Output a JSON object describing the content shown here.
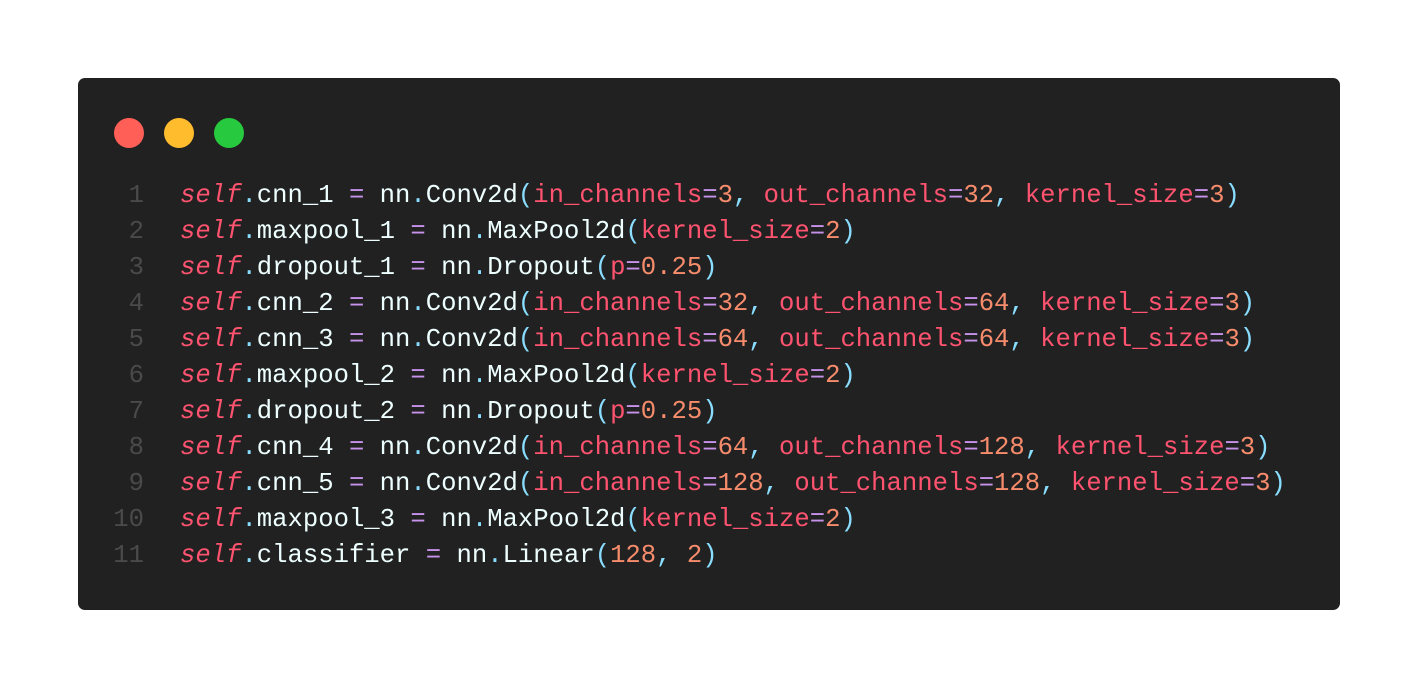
{
  "window": {
    "controls": [
      {
        "name": "close",
        "color": "#ff5f56"
      },
      {
        "name": "minimize",
        "color": "#ffbd2e"
      },
      {
        "name": "maximize",
        "color": "#27c93f"
      }
    ]
  },
  "code": {
    "lines": [
      {
        "n": "1",
        "tokens": [
          [
            "self",
            "self"
          ],
          [
            "punc",
            "."
          ],
          [
            "id",
            "cnn_1 "
          ],
          [
            "op",
            "="
          ],
          [
            "id",
            " nn"
          ],
          [
            "punc",
            "."
          ],
          [
            "id",
            "Conv2d"
          ],
          [
            "punc",
            "("
          ],
          [
            "kw",
            "in_channels"
          ],
          [
            "op",
            "="
          ],
          [
            "num",
            "3"
          ],
          [
            "punc",
            ", "
          ],
          [
            "kw",
            "out_channels"
          ],
          [
            "op",
            "="
          ],
          [
            "num",
            "32"
          ],
          [
            "punc",
            ", "
          ],
          [
            "kw",
            "kernel_size"
          ],
          [
            "op",
            "="
          ],
          [
            "num",
            "3"
          ],
          [
            "punc",
            ")"
          ]
        ]
      },
      {
        "n": "2",
        "tokens": [
          [
            "self",
            "self"
          ],
          [
            "punc",
            "."
          ],
          [
            "id",
            "maxpool_1 "
          ],
          [
            "op",
            "="
          ],
          [
            "id",
            " nn"
          ],
          [
            "punc",
            "."
          ],
          [
            "id",
            "MaxPool2d"
          ],
          [
            "punc",
            "("
          ],
          [
            "kw",
            "kernel_size"
          ],
          [
            "op",
            "="
          ],
          [
            "num",
            "2"
          ],
          [
            "punc",
            ")"
          ]
        ]
      },
      {
        "n": "3",
        "tokens": [
          [
            "self",
            "self"
          ],
          [
            "punc",
            "."
          ],
          [
            "id",
            "dropout_1 "
          ],
          [
            "op",
            "="
          ],
          [
            "id",
            " nn"
          ],
          [
            "punc",
            "."
          ],
          [
            "id",
            "Dropout"
          ],
          [
            "punc",
            "("
          ],
          [
            "kw",
            "p"
          ],
          [
            "op",
            "="
          ],
          [
            "num",
            "0.25"
          ],
          [
            "punc",
            ")"
          ]
        ]
      },
      {
        "n": "4",
        "tokens": [
          [
            "self",
            "self"
          ],
          [
            "punc",
            "."
          ],
          [
            "id",
            "cnn_2 "
          ],
          [
            "op",
            "="
          ],
          [
            "id",
            " nn"
          ],
          [
            "punc",
            "."
          ],
          [
            "id",
            "Conv2d"
          ],
          [
            "punc",
            "("
          ],
          [
            "kw",
            "in_channels"
          ],
          [
            "op",
            "="
          ],
          [
            "num",
            "32"
          ],
          [
            "punc",
            ", "
          ],
          [
            "kw",
            "out_channels"
          ],
          [
            "op",
            "="
          ],
          [
            "num",
            "64"
          ],
          [
            "punc",
            ", "
          ],
          [
            "kw",
            "kernel_size"
          ],
          [
            "op",
            "="
          ],
          [
            "num",
            "3"
          ],
          [
            "punc",
            ")"
          ]
        ]
      },
      {
        "n": "5",
        "tokens": [
          [
            "self",
            "self"
          ],
          [
            "punc",
            "."
          ],
          [
            "id",
            "cnn_3 "
          ],
          [
            "op",
            "="
          ],
          [
            "id",
            " nn"
          ],
          [
            "punc",
            "."
          ],
          [
            "id",
            "Conv2d"
          ],
          [
            "punc",
            "("
          ],
          [
            "kw",
            "in_channels"
          ],
          [
            "op",
            "="
          ],
          [
            "num",
            "64"
          ],
          [
            "punc",
            ", "
          ],
          [
            "kw",
            "out_channels"
          ],
          [
            "op",
            "="
          ],
          [
            "num",
            "64"
          ],
          [
            "punc",
            ", "
          ],
          [
            "kw",
            "kernel_size"
          ],
          [
            "op",
            "="
          ],
          [
            "num",
            "3"
          ],
          [
            "punc",
            ")"
          ]
        ]
      },
      {
        "n": "6",
        "tokens": [
          [
            "self",
            "self"
          ],
          [
            "punc",
            "."
          ],
          [
            "id",
            "maxpool_2 "
          ],
          [
            "op",
            "="
          ],
          [
            "id",
            " nn"
          ],
          [
            "punc",
            "."
          ],
          [
            "id",
            "MaxPool2d"
          ],
          [
            "punc",
            "("
          ],
          [
            "kw",
            "kernel_size"
          ],
          [
            "op",
            "="
          ],
          [
            "num",
            "2"
          ],
          [
            "punc",
            ")"
          ]
        ]
      },
      {
        "n": "7",
        "tokens": [
          [
            "self",
            "self"
          ],
          [
            "punc",
            "."
          ],
          [
            "id",
            "dropout_2 "
          ],
          [
            "op",
            "="
          ],
          [
            "id",
            " nn"
          ],
          [
            "punc",
            "."
          ],
          [
            "id",
            "Dropout"
          ],
          [
            "punc",
            "("
          ],
          [
            "kw",
            "p"
          ],
          [
            "op",
            "="
          ],
          [
            "num",
            "0.25"
          ],
          [
            "punc",
            ")"
          ]
        ]
      },
      {
        "n": "8",
        "tokens": [
          [
            "self",
            "self"
          ],
          [
            "punc",
            "."
          ],
          [
            "id",
            "cnn_4 "
          ],
          [
            "op",
            "="
          ],
          [
            "id",
            " nn"
          ],
          [
            "punc",
            "."
          ],
          [
            "id",
            "Conv2d"
          ],
          [
            "punc",
            "("
          ],
          [
            "kw",
            "in_channels"
          ],
          [
            "op",
            "="
          ],
          [
            "num",
            "64"
          ],
          [
            "punc",
            ", "
          ],
          [
            "kw",
            "out_channels"
          ],
          [
            "op",
            "="
          ],
          [
            "num",
            "128"
          ],
          [
            "punc",
            ", "
          ],
          [
            "kw",
            "kernel_size"
          ],
          [
            "op",
            "="
          ],
          [
            "num",
            "3"
          ],
          [
            "punc",
            ")"
          ]
        ]
      },
      {
        "n": "9",
        "tokens": [
          [
            "self",
            "self"
          ],
          [
            "punc",
            "."
          ],
          [
            "id",
            "cnn_5 "
          ],
          [
            "op",
            "="
          ],
          [
            "id",
            " nn"
          ],
          [
            "punc",
            "."
          ],
          [
            "id",
            "Conv2d"
          ],
          [
            "punc",
            "("
          ],
          [
            "kw",
            "in_channels"
          ],
          [
            "op",
            "="
          ],
          [
            "num",
            "128"
          ],
          [
            "punc",
            ", "
          ],
          [
            "kw",
            "out_channels"
          ],
          [
            "op",
            "="
          ],
          [
            "num",
            "128"
          ],
          [
            "punc",
            ", "
          ],
          [
            "kw",
            "kernel_size"
          ],
          [
            "op",
            "="
          ],
          [
            "num",
            "3"
          ],
          [
            "punc",
            ")"
          ]
        ]
      },
      {
        "n": "10",
        "tokens": [
          [
            "self",
            "self"
          ],
          [
            "punc",
            "."
          ],
          [
            "id",
            "maxpool_3 "
          ],
          [
            "op",
            "="
          ],
          [
            "id",
            " nn"
          ],
          [
            "punc",
            "."
          ],
          [
            "id",
            "MaxPool2d"
          ],
          [
            "punc",
            "("
          ],
          [
            "kw",
            "kernel_size"
          ],
          [
            "op",
            "="
          ],
          [
            "num",
            "2"
          ],
          [
            "punc",
            ")"
          ]
        ]
      },
      {
        "n": "11",
        "tokens": [
          [
            "self",
            "self"
          ],
          [
            "punc",
            "."
          ],
          [
            "id",
            "classifier "
          ],
          [
            "op",
            "="
          ],
          [
            "id",
            " nn"
          ],
          [
            "punc",
            "."
          ],
          [
            "id",
            "Linear"
          ],
          [
            "punc",
            "("
          ],
          [
            "num",
            "128"
          ],
          [
            "punc",
            ", "
          ],
          [
            "num",
            "2"
          ],
          [
            "punc",
            ")"
          ]
        ]
      }
    ]
  }
}
